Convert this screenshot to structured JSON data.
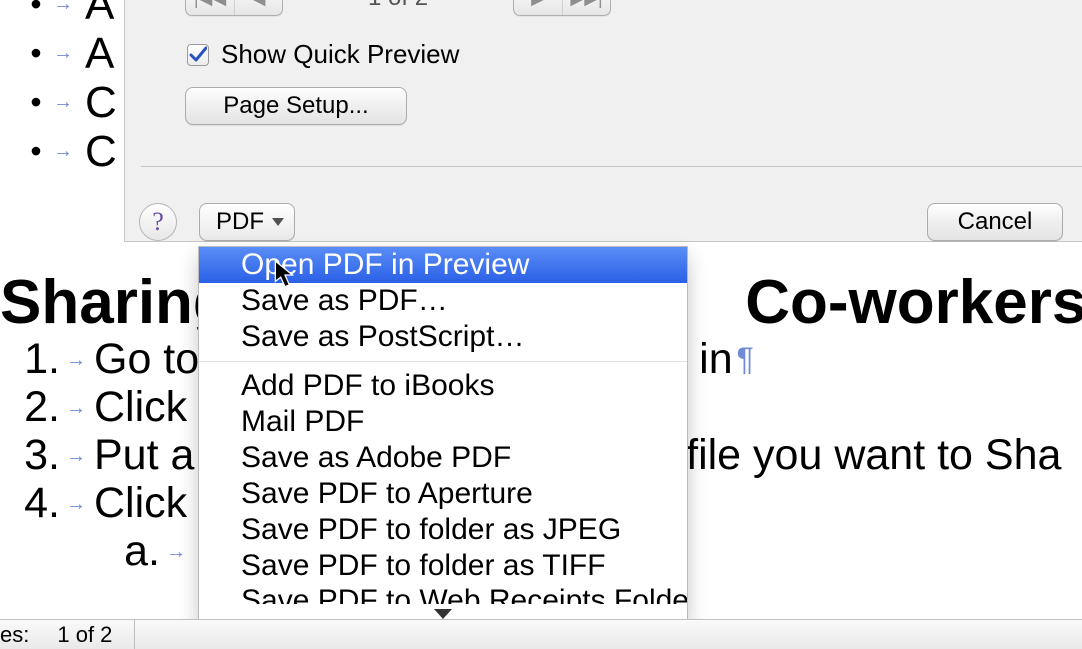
{
  "background": {
    "bullets": [
      "A",
      "A",
      "C",
      "C"
    ],
    "heading_left": "Sharing ",
    "heading_right": " Co-workers an",
    "list": [
      {
        "num": "1.",
        "prefix": "Go to ",
        "suffix": " in"
      },
      {
        "num": "2.",
        "prefix": "Click o",
        "suffix": ""
      },
      {
        "num": "3.",
        "prefix": "Put a ",
        "suffix": "the file you want to Sha"
      },
      {
        "num": "4.",
        "prefix": "Click o",
        "suffix": ""
      }
    ],
    "sub_label": "a."
  },
  "dialog": {
    "page_indicator": "1 of 2",
    "show_quick_preview_label": "Show Quick Preview",
    "show_quick_preview_checked": true,
    "page_setup_label": "Page Setup...",
    "help_label": "?",
    "pdf_button_label": "PDF",
    "cancel_label": "Cancel"
  },
  "menu": {
    "items": [
      "Open PDF in Preview",
      "Save as PDF…",
      "Save as PostScript…",
      "Add PDF to iBooks",
      "Mail PDF",
      "Save as Adobe PDF",
      "Save PDF to Aperture",
      "Save PDF to folder as JPEG",
      "Save PDF to folder as TIFF",
      "Save PDF to Web Receipts Folder"
    ],
    "highlighted_index": 0,
    "separator_after_index": 2
  },
  "statusbar": {
    "label_prefix": "es:",
    "page_count": "1 of 2"
  }
}
